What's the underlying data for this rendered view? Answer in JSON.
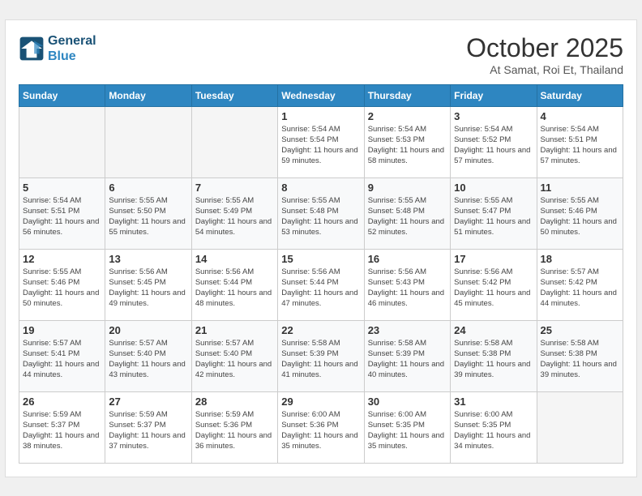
{
  "header": {
    "logo_line1": "General",
    "logo_line2": "Blue",
    "month": "October 2025",
    "location": "At Samat, Roi Et, Thailand"
  },
  "weekdays": [
    "Sunday",
    "Monday",
    "Tuesday",
    "Wednesday",
    "Thursday",
    "Friday",
    "Saturday"
  ],
  "weeks": [
    [
      {
        "day": "",
        "sunrise": "",
        "sunset": "",
        "daylight": ""
      },
      {
        "day": "",
        "sunrise": "",
        "sunset": "",
        "daylight": ""
      },
      {
        "day": "",
        "sunrise": "",
        "sunset": "",
        "daylight": ""
      },
      {
        "day": "1",
        "sunrise": "Sunrise: 5:54 AM",
        "sunset": "Sunset: 5:54 PM",
        "daylight": "Daylight: 11 hours and 59 minutes."
      },
      {
        "day": "2",
        "sunrise": "Sunrise: 5:54 AM",
        "sunset": "Sunset: 5:53 PM",
        "daylight": "Daylight: 11 hours and 58 minutes."
      },
      {
        "day": "3",
        "sunrise": "Sunrise: 5:54 AM",
        "sunset": "Sunset: 5:52 PM",
        "daylight": "Daylight: 11 hours and 57 minutes."
      },
      {
        "day": "4",
        "sunrise": "Sunrise: 5:54 AM",
        "sunset": "Sunset: 5:51 PM",
        "daylight": "Daylight: 11 hours and 57 minutes."
      }
    ],
    [
      {
        "day": "5",
        "sunrise": "Sunrise: 5:54 AM",
        "sunset": "Sunset: 5:51 PM",
        "daylight": "Daylight: 11 hours and 56 minutes."
      },
      {
        "day": "6",
        "sunrise": "Sunrise: 5:55 AM",
        "sunset": "Sunset: 5:50 PM",
        "daylight": "Daylight: 11 hours and 55 minutes."
      },
      {
        "day": "7",
        "sunrise": "Sunrise: 5:55 AM",
        "sunset": "Sunset: 5:49 PM",
        "daylight": "Daylight: 11 hours and 54 minutes."
      },
      {
        "day": "8",
        "sunrise": "Sunrise: 5:55 AM",
        "sunset": "Sunset: 5:48 PM",
        "daylight": "Daylight: 11 hours and 53 minutes."
      },
      {
        "day": "9",
        "sunrise": "Sunrise: 5:55 AM",
        "sunset": "Sunset: 5:48 PM",
        "daylight": "Daylight: 11 hours and 52 minutes."
      },
      {
        "day": "10",
        "sunrise": "Sunrise: 5:55 AM",
        "sunset": "Sunset: 5:47 PM",
        "daylight": "Daylight: 11 hours and 51 minutes."
      },
      {
        "day": "11",
        "sunrise": "Sunrise: 5:55 AM",
        "sunset": "Sunset: 5:46 PM",
        "daylight": "Daylight: 11 hours and 50 minutes."
      }
    ],
    [
      {
        "day": "12",
        "sunrise": "Sunrise: 5:55 AM",
        "sunset": "Sunset: 5:46 PM",
        "daylight": "Daylight: 11 hours and 50 minutes."
      },
      {
        "day": "13",
        "sunrise": "Sunrise: 5:56 AM",
        "sunset": "Sunset: 5:45 PM",
        "daylight": "Daylight: 11 hours and 49 minutes."
      },
      {
        "day": "14",
        "sunrise": "Sunrise: 5:56 AM",
        "sunset": "Sunset: 5:44 PM",
        "daylight": "Daylight: 11 hours and 48 minutes."
      },
      {
        "day": "15",
        "sunrise": "Sunrise: 5:56 AM",
        "sunset": "Sunset: 5:44 PM",
        "daylight": "Daylight: 11 hours and 47 minutes."
      },
      {
        "day": "16",
        "sunrise": "Sunrise: 5:56 AM",
        "sunset": "Sunset: 5:43 PM",
        "daylight": "Daylight: 11 hours and 46 minutes."
      },
      {
        "day": "17",
        "sunrise": "Sunrise: 5:56 AM",
        "sunset": "Sunset: 5:42 PM",
        "daylight": "Daylight: 11 hours and 45 minutes."
      },
      {
        "day": "18",
        "sunrise": "Sunrise: 5:57 AM",
        "sunset": "Sunset: 5:42 PM",
        "daylight": "Daylight: 11 hours and 44 minutes."
      }
    ],
    [
      {
        "day": "19",
        "sunrise": "Sunrise: 5:57 AM",
        "sunset": "Sunset: 5:41 PM",
        "daylight": "Daylight: 11 hours and 44 minutes."
      },
      {
        "day": "20",
        "sunrise": "Sunrise: 5:57 AM",
        "sunset": "Sunset: 5:40 PM",
        "daylight": "Daylight: 11 hours and 43 minutes."
      },
      {
        "day": "21",
        "sunrise": "Sunrise: 5:57 AM",
        "sunset": "Sunset: 5:40 PM",
        "daylight": "Daylight: 11 hours and 42 minutes."
      },
      {
        "day": "22",
        "sunrise": "Sunrise: 5:58 AM",
        "sunset": "Sunset: 5:39 PM",
        "daylight": "Daylight: 11 hours and 41 minutes."
      },
      {
        "day": "23",
        "sunrise": "Sunrise: 5:58 AM",
        "sunset": "Sunset: 5:39 PM",
        "daylight": "Daylight: 11 hours and 40 minutes."
      },
      {
        "day": "24",
        "sunrise": "Sunrise: 5:58 AM",
        "sunset": "Sunset: 5:38 PM",
        "daylight": "Daylight: 11 hours and 39 minutes."
      },
      {
        "day": "25",
        "sunrise": "Sunrise: 5:58 AM",
        "sunset": "Sunset: 5:38 PM",
        "daylight": "Daylight: 11 hours and 39 minutes."
      }
    ],
    [
      {
        "day": "26",
        "sunrise": "Sunrise: 5:59 AM",
        "sunset": "Sunset: 5:37 PM",
        "daylight": "Daylight: 11 hours and 38 minutes."
      },
      {
        "day": "27",
        "sunrise": "Sunrise: 5:59 AM",
        "sunset": "Sunset: 5:37 PM",
        "daylight": "Daylight: 11 hours and 37 minutes."
      },
      {
        "day": "28",
        "sunrise": "Sunrise: 5:59 AM",
        "sunset": "Sunset: 5:36 PM",
        "daylight": "Daylight: 11 hours and 36 minutes."
      },
      {
        "day": "29",
        "sunrise": "Sunrise: 6:00 AM",
        "sunset": "Sunset: 5:36 PM",
        "daylight": "Daylight: 11 hours and 35 minutes."
      },
      {
        "day": "30",
        "sunrise": "Sunrise: 6:00 AM",
        "sunset": "Sunset: 5:35 PM",
        "daylight": "Daylight: 11 hours and 35 minutes."
      },
      {
        "day": "31",
        "sunrise": "Sunrise: 6:00 AM",
        "sunset": "Sunset: 5:35 PM",
        "daylight": "Daylight: 11 hours and 34 minutes."
      },
      {
        "day": "",
        "sunrise": "",
        "sunset": "",
        "daylight": ""
      }
    ]
  ]
}
